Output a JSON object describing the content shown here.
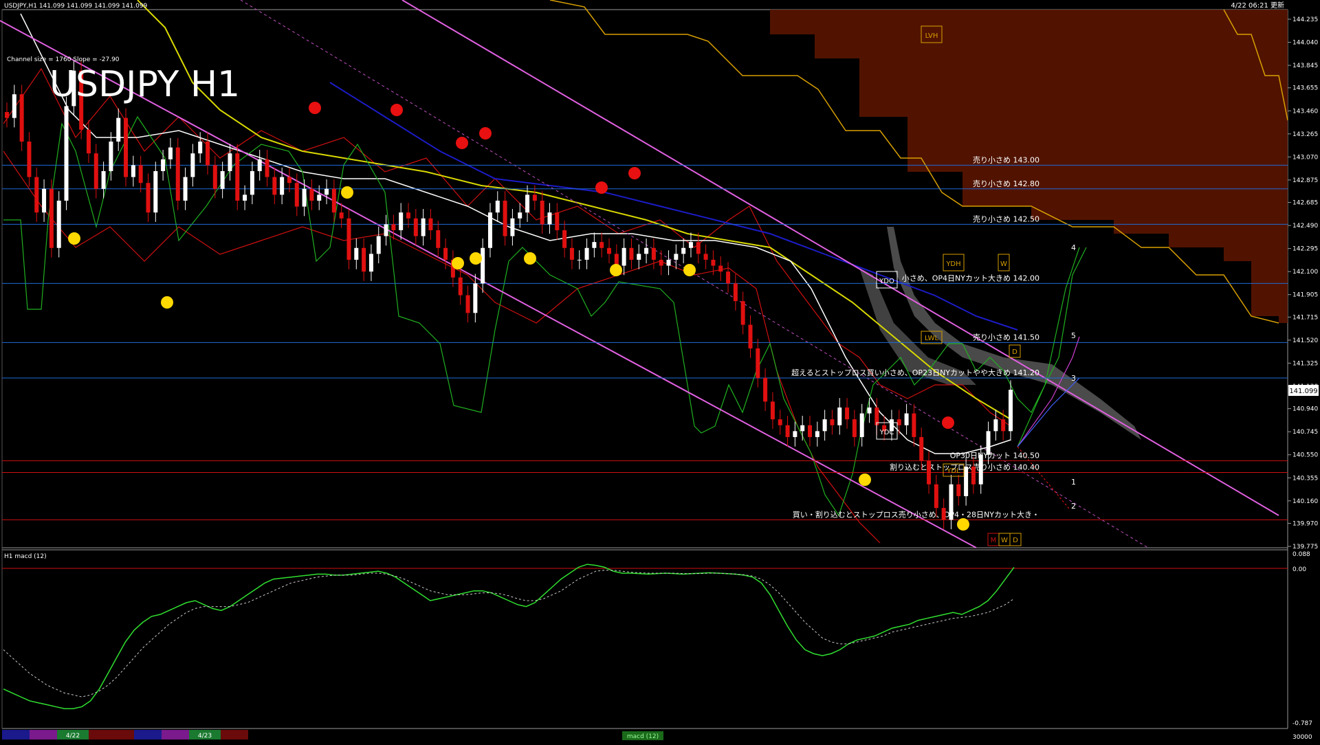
{
  "header": {
    "symbol_info": "USDJPY,H1  141.099 141.099 141.099 141.099",
    "updated": "4/22 06:21 更新"
  },
  "main": {
    "big_title": "USDJPY H1",
    "channel_info": "Channel size = 1760 Slope = -27.90",
    "price_axis": [
      "144.235",
      "144.040",
      "143.845",
      "143.655",
      "143.460",
      "143.265",
      "143.070",
      "142.875",
      "142.685",
      "142.490",
      "142.295",
      "142.100",
      "141.905",
      "141.715",
      "141.520",
      "141.325",
      "141.130",
      "140.940",
      "140.745",
      "140.550",
      "140.355",
      "140.160",
      "139.970",
      "139.775"
    ],
    "current_price": "141.099",
    "levels": [
      {
        "price": 143.0,
        "label": "売り小さめ 143.00",
        "color": "#1e6bd6"
      },
      {
        "price": 142.8,
        "label": "売り小さめ 142.80",
        "color": "#1e6bd6"
      },
      {
        "price": 142.5,
        "label": "売り小さめ 142.50",
        "color": "#1e6bd6"
      },
      {
        "price": 142.0,
        "label": "小さめ、OP4日NYカット大きめ 142.00",
        "color": "#1e6bd6"
      },
      {
        "price": 141.5,
        "label": "売り小さめ 141.50",
        "color": "#1e6bd6"
      },
      {
        "price": 141.2,
        "label": "超えるとストップロス買い小さめ、OP23日NYカットやや大きめ 141.20",
        "color": "#1e6bd6"
      },
      {
        "price": 140.5,
        "label": "OP30日NYカット 140.50",
        "color": "#d01010"
      },
      {
        "price": 140.4,
        "label": "割り込むとストップロス売り小さめ 140.40",
        "color": "#d01010"
      },
      {
        "price": 140.0,
        "label": "買い・割り込むとストップロス売り小さめ、OP4・28日NYカット大き・",
        "color": "#d01010"
      }
    ],
    "tags": [
      {
        "text": "LVH",
        "color": "#d9a000"
      },
      {
        "text": "YDH",
        "color": "#d9a000"
      },
      {
        "text": "W",
        "color": "#d9a000"
      },
      {
        "text": "LWL",
        "color": "#d9a000"
      },
      {
        "text": "D",
        "color": "#d9a000"
      },
      {
        "text": "YDO",
        "color": "#ffffff"
      },
      {
        "text": "YDC",
        "color": "#ffffff"
      },
      {
        "text": "YDL",
        "color": "#d9a000"
      },
      {
        "text": "M",
        "color": "#d01010"
      },
      {
        "text": "W",
        "color": "#d9a000"
      },
      {
        "text": "D",
        "color": "#d9a000"
      }
    ],
    "projection_numbers": [
      "4",
      "5",
      "3",
      "1",
      "2"
    ]
  },
  "macd": {
    "label": "H1  macd (12)",
    "axis_top": "0.088",
    "axis_zero": "0.00",
    "axis_bottom": "-0.787"
  },
  "footer": {
    "dates": [
      "4/22",
      "4/23"
    ],
    "indicator_button": "macd (12)",
    "bottom_value": "30000"
  },
  "chart_data": {
    "type": "candlestick",
    "title": "USDJPY H1",
    "ylim": [
      139.775,
      144.235
    ],
    "macd_ylim": [
      -0.787,
      0.088
    ],
    "close": [
      143.4,
      143.6,
      143.2,
      142.9,
      142.6,
      142.8,
      142.3,
      142.7,
      143.5,
      143.8,
      143.3,
      143.1,
      142.8,
      142.95,
      143.2,
      143.4,
      142.9,
      143.0,
      142.85,
      142.6,
      142.95,
      143.05,
      143.15,
      142.7,
      142.9,
      143.1,
      143.2,
      143.0,
      142.8,
      142.95,
      143.1,
      142.7,
      142.75,
      142.95,
      143.05,
      142.9,
      142.75,
      142.9,
      142.85,
      142.65,
      142.8,
      142.7,
      142.75,
      142.8,
      142.6,
      142.55,
      142.2,
      142.3,
      142.1,
      142.25,
      142.4,
      142.5,
      142.45,
      142.6,
      142.55,
      142.4,
      142.55,
      142.45,
      142.3,
      142.2,
      142.05,
      141.9,
      141.75,
      142.0,
      142.3,
      142.6,
      142.7,
      142.4,
      142.55,
      142.6,
      142.75,
      142.7,
      142.5,
      142.6,
      142.45,
      142.3,
      142.2,
      142.2,
      142.3,
      142.35,
      142.3,
      142.25,
      142.15,
      142.3,
      142.2,
      142.25,
      142.3,
      142.2,
      142.15,
      142.2,
      142.25,
      142.3,
      142.35,
      142.25,
      142.2,
      142.15,
      142.1,
      142.0,
      141.85,
      141.65,
      141.45,
      141.2,
      141.0,
      140.85,
      140.8,
      140.7,
      140.75,
      140.8,
      140.7,
      140.75,
      140.85,
      140.8,
      140.95,
      140.85,
      140.7,
      140.9,
      140.95,
      140.8,
      140.75,
      140.85,
      140.8,
      140.9,
      140.7,
      140.5,
      140.3,
      140.1,
      140.0,
      140.3,
      140.2,
      140.45,
      140.3,
      140.55,
      140.75,
      140.85,
      140.75,
      141.1
    ],
    "macd": [
      -0.6,
      -0.62,
      -0.64,
      -0.66,
      -0.67,
      -0.68,
      -0.69,
      -0.7,
      -0.7,
      -0.69,
      -0.66,
      -0.6,
      -0.52,
      -0.44,
      -0.36,
      -0.3,
      -0.26,
      -0.23,
      -0.22,
      -0.2,
      -0.18,
      -0.16,
      -0.15,
      -0.17,
      -0.19,
      -0.2,
      -0.18,
      -0.15,
      -0.12,
      -0.09,
      -0.06,
      -0.04,
      -0.035,
      -0.03,
      -0.025,
      -0.02,
      -0.015,
      -0.015,
      -0.02,
      -0.02,
      -0.015,
      -0.01,
      -0.005,
      0.0,
      -0.01,
      -0.03,
      -0.06,
      -0.09,
      -0.12,
      -0.15,
      -0.14,
      -0.13,
      -0.12,
      -0.11,
      -0.1,
      -0.1,
      -0.11,
      -0.13,
      -0.15,
      -0.17,
      -0.18,
      -0.16,
      -0.12,
      -0.08,
      -0.04,
      -0.01,
      0.02,
      0.035,
      0.03,
      0.02,
      0.0,
      -0.01,
      -0.01,
      -0.012,
      -0.015,
      -0.012,
      -0.01,
      -0.012,
      -0.015,
      -0.012,
      -0.01,
      -0.008,
      -0.01,
      -0.012,
      -0.015,
      -0.02,
      -0.03,
      -0.06,
      -0.12,
      -0.2,
      -0.28,
      -0.35,
      -0.4,
      -0.42,
      -0.43,
      -0.42,
      -0.4,
      -0.37,
      -0.35,
      -0.34,
      -0.33,
      -0.31,
      -0.29,
      -0.28,
      -0.27,
      -0.25,
      -0.24,
      -0.23,
      -0.22,
      -0.21,
      -0.22,
      -0.2,
      -0.18,
      -0.15,
      -0.1,
      -0.04,
      0.02
    ],
    "signal": [
      -0.4,
      -0.44,
      -0.48,
      -0.52,
      -0.55,
      -0.58,
      -0.6,
      -0.62,
      -0.63,
      -0.64,
      -0.63,
      -0.61,
      -0.58,
      -0.54,
      -0.49,
      -0.44,
      -0.39,
      -0.35,
      -0.31,
      -0.27,
      -0.24,
      -0.21,
      -0.19,
      -0.18,
      -0.18,
      -0.18,
      -0.18,
      -0.17,
      -0.16,
      -0.14,
      -0.12,
      -0.1,
      -0.08,
      -0.06,
      -0.05,
      -0.04,
      -0.03,
      -0.025,
      -0.02,
      -0.02,
      -0.02,
      -0.015,
      -0.01,
      -0.01,
      -0.015,
      -0.025,
      -0.04,
      -0.06,
      -0.08,
      -0.1,
      -0.11,
      -0.12,
      -0.12,
      -0.12,
      -0.115,
      -0.11,
      -0.11,
      -0.115,
      -0.125,
      -0.14,
      -0.15,
      -0.15,
      -0.14,
      -0.12,
      -0.1,
      -0.07,
      -0.04,
      -0.02,
      0.0,
      0.005,
      0.005,
      0.0,
      -0.005,
      -0.008,
      -0.01,
      -0.01,
      -0.01,
      -0.01,
      -0.012,
      -0.012,
      -0.012,
      -0.01,
      -0.01,
      -0.012,
      -0.015,
      -0.018,
      -0.025,
      -0.04,
      -0.07,
      -0.11,
      -0.16,
      -0.21,
      -0.26,
      -0.3,
      -0.34,
      -0.36,
      -0.37,
      -0.37,
      -0.36,
      -0.35,
      -0.34,
      -0.33,
      -0.31,
      -0.3,
      -0.29,
      -0.28,
      -0.27,
      -0.26,
      -0.25,
      -0.24,
      -0.235,
      -0.23,
      -0.22,
      -0.21,
      -0.19,
      -0.17,
      -0.14
    ]
  }
}
